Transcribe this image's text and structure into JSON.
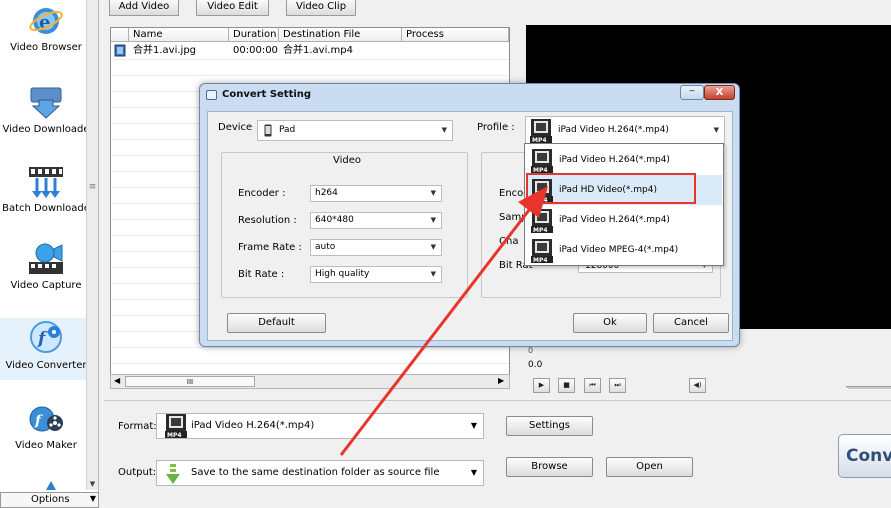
{
  "sidebar": {
    "items": [
      {
        "label": "Video Browser",
        "icon": "globe-e-icon"
      },
      {
        "label": "Video Downloade",
        "icon": "download-arrow-icon"
      },
      {
        "label": "Batch Downloade",
        "icon": "batch-download-icon"
      },
      {
        "label": "Video Capture",
        "icon": "camera-capture-icon"
      },
      {
        "label": "Video Converter",
        "icon": "convert-icon"
      },
      {
        "label": "Video Maker",
        "icon": "film-reel-icon"
      }
    ],
    "options_label": "Options"
  },
  "toolbar": {
    "add_video": "Add Video",
    "video_edit": "Video Edit",
    "video_clip": "Video Clip"
  },
  "file_list": {
    "columns": [
      "Name",
      "Duration",
      "Destination File",
      "Process"
    ],
    "rows": [
      {
        "name": "合并1.avi.jpg",
        "duration": "00:00:00",
        "destination": "合并1.avi.mp4",
        "process": ""
      }
    ],
    "hscroll_grip": "III"
  },
  "player": {
    "time": "0.0",
    "tick": "0"
  },
  "bottom": {
    "format_label": "Format:",
    "format_value": "iPad Video H.264(*.mp4)",
    "output_label": "Output:",
    "output_value": "Save to the same destination folder as source file",
    "settings": "Settings",
    "browse": "Browse",
    "open": "Open",
    "convert": "Conve"
  },
  "dialog": {
    "title": "Convert Setting",
    "device_label": "Device",
    "device_value": "Pad",
    "profile_label": "Profile :",
    "profile_value": "iPad Video H.264(*.mp4)",
    "video_group_title": "Video",
    "encoder_label": "Encoder :",
    "encoder_value": "h264",
    "resolution_label": "Resolution :",
    "resolution_value": "640*480",
    "frame_rate_label": "Frame Rate :",
    "frame_rate_value": "auto",
    "bit_rate_label": "Bit Rate :",
    "bit_rate_value": "High quality",
    "audio_encoder_label": "Encod",
    "audio_sample_label": "Sampl",
    "audio_channel_label": "Cha",
    "audio_bitrate_label": "Bit Rat",
    "audio_bitrate_value": "128000",
    "default": "Default",
    "ok": "Ok",
    "cancel": "Cancel",
    "close_glyph": "X",
    "min_glyph": "‒"
  },
  "profile_dropdown": {
    "items": [
      "iPad Video H.264(*.mp4)",
      "iPad HD Video(*.mp4)",
      "iPad Video H.264(*.mp4)",
      "iPad Video MPEG-4(*.mp4)"
    ],
    "highlighted_index": 1
  },
  "icon_labels": {
    "mp4": "MP4"
  },
  "colors": {
    "annotation_red": "#e8352b",
    "dialog_frame": "#c9dcf1",
    "highlight": "#dbeaf9"
  }
}
